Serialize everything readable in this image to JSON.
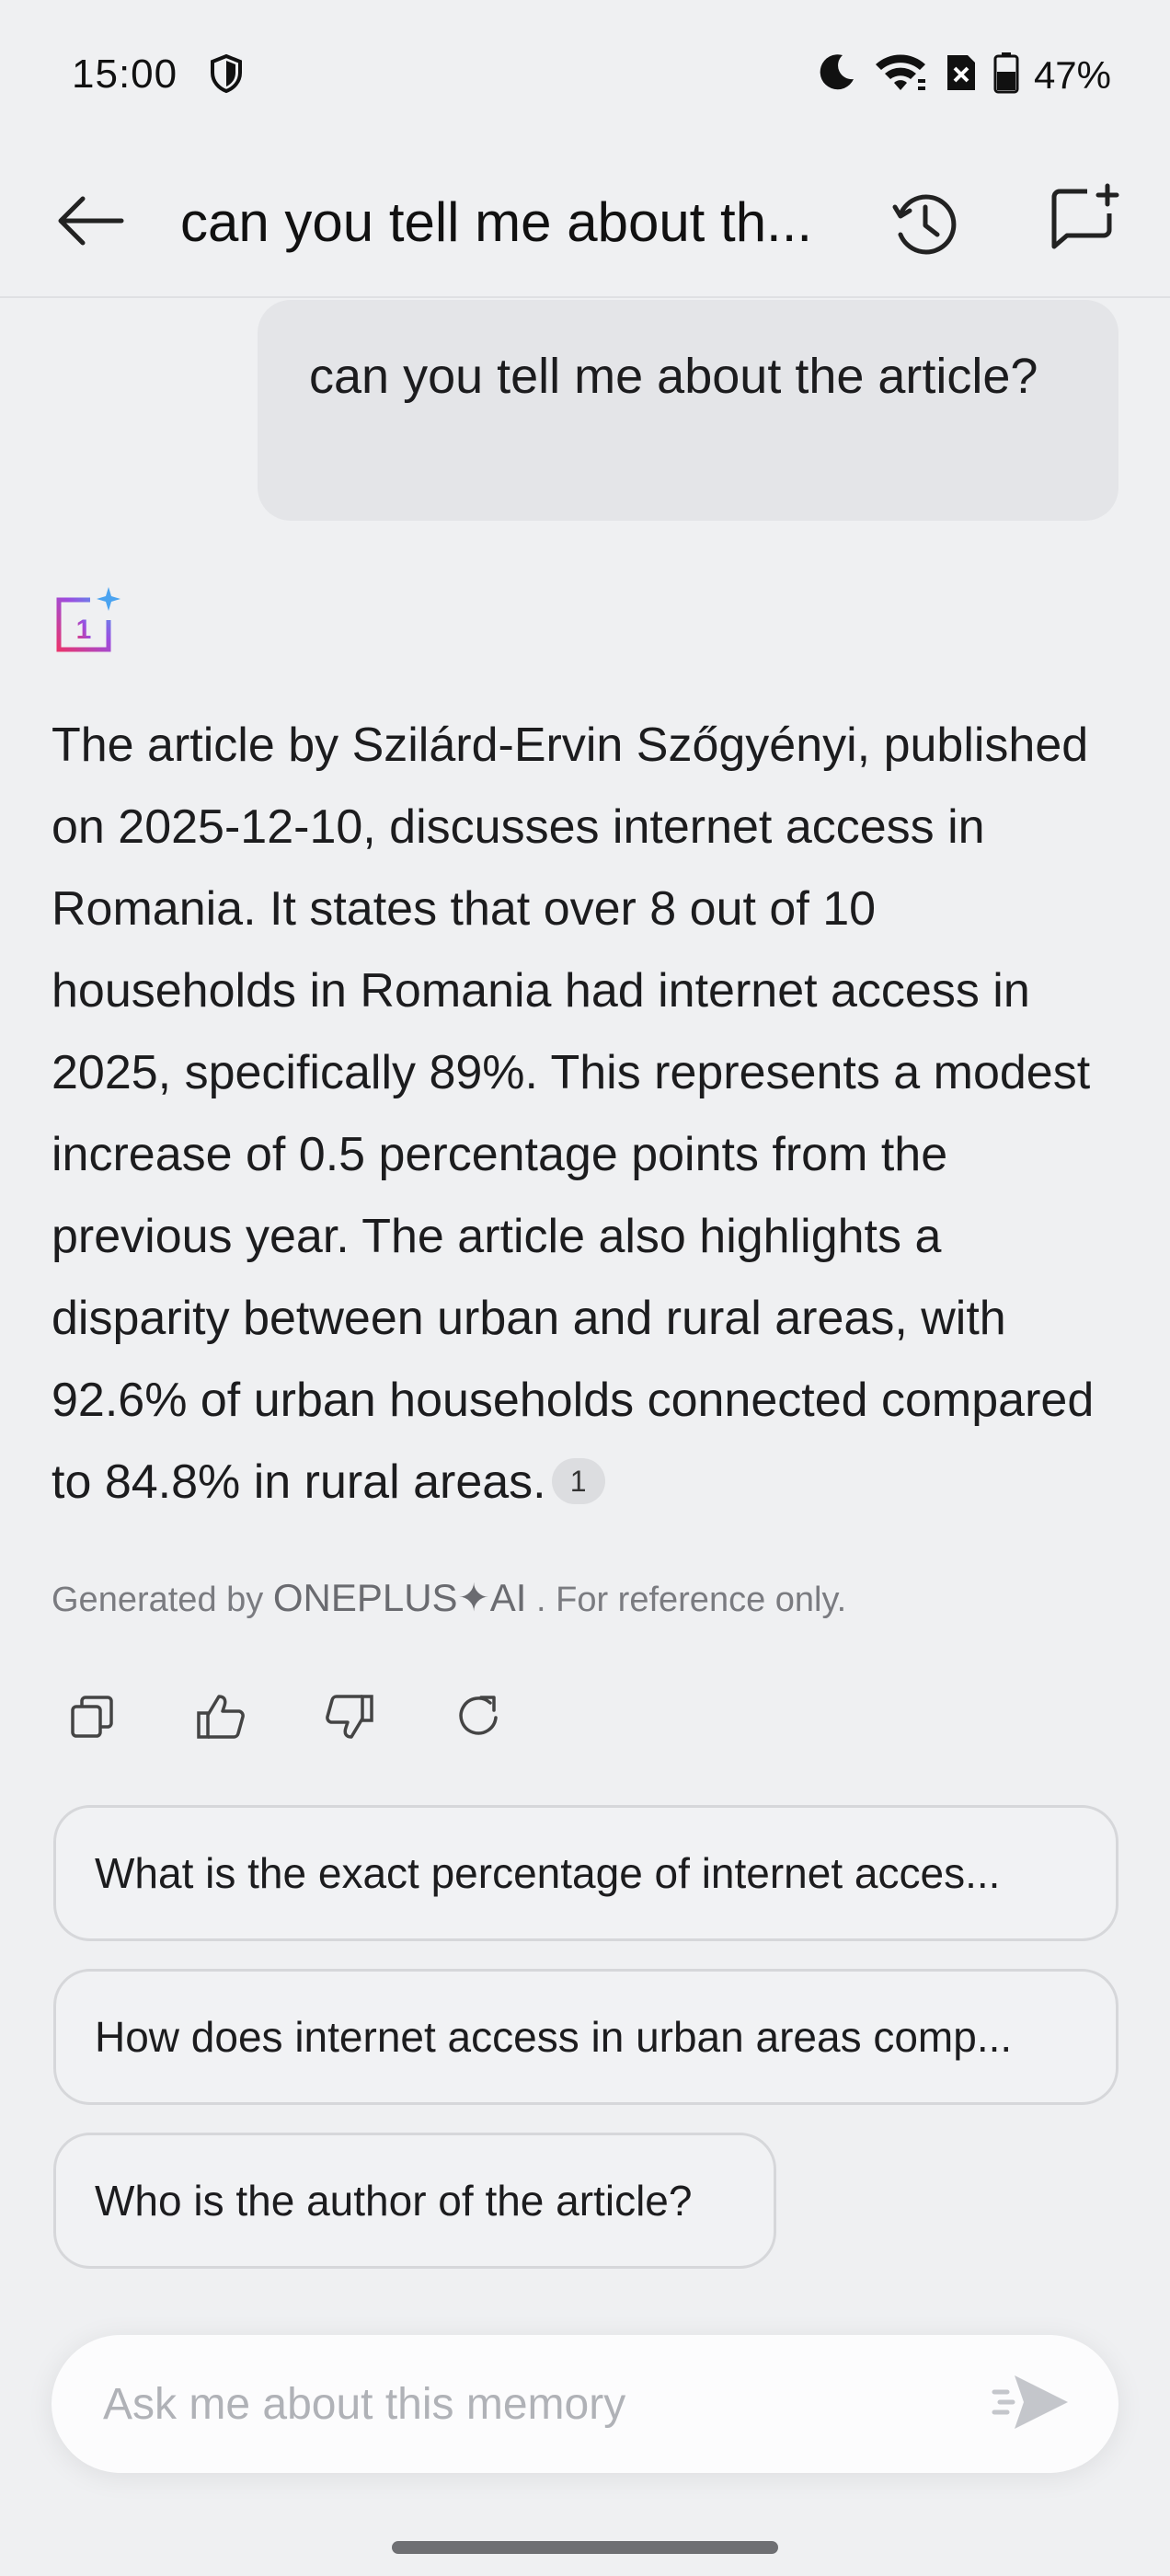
{
  "status_bar": {
    "time": "15:00",
    "battery": "47%",
    "icons": [
      "shield-icon",
      "moon-icon",
      "wifi-icon",
      "sim-off-icon",
      "battery-icon"
    ]
  },
  "header": {
    "title": "can you tell me about th...",
    "icons": [
      "back-arrow-icon",
      "history-icon",
      "new-chat-icon"
    ]
  },
  "conversation": {
    "user_message": "can you tell me about the article?",
    "ai_logo": "oneplus-ai-logo",
    "answer": "The article by Szilárd-Ervin Szőgyényi, published on 2025-12-10, discusses internet access in Romania. It states that over 8 out of 10 households in Romania had internet access in 2025, specifically 89%. This represents a modest increase of 0.5 percentage points from the previous year. The article also highlights a disparity between urban and rural areas, with 92.6% of urban households connected compared to 84.8% in rural areas.",
    "citation": "1",
    "disclaimer_prefix": "Generated by",
    "disclaimer_brand": "ONEPLUS✦AI",
    "disclaimer_suffix": ". For reference only."
  },
  "actions": [
    "copy-icon",
    "thumbs-up-icon",
    "thumbs-down-icon",
    "regenerate-icon"
  ],
  "suggestions": [
    "What is the exact percentage of internet acces...",
    "How does internet access in urban areas comp...",
    "Who is the author of the article?"
  ],
  "input": {
    "placeholder": "Ask me about this memory",
    "value": ""
  },
  "colors": {
    "background": "#eff0f2",
    "bubble": "#e4e5e8",
    "logo_pink": "#e8356f",
    "logo_purple": "#9b4de0",
    "logo_blue": "#4aa3f0"
  }
}
